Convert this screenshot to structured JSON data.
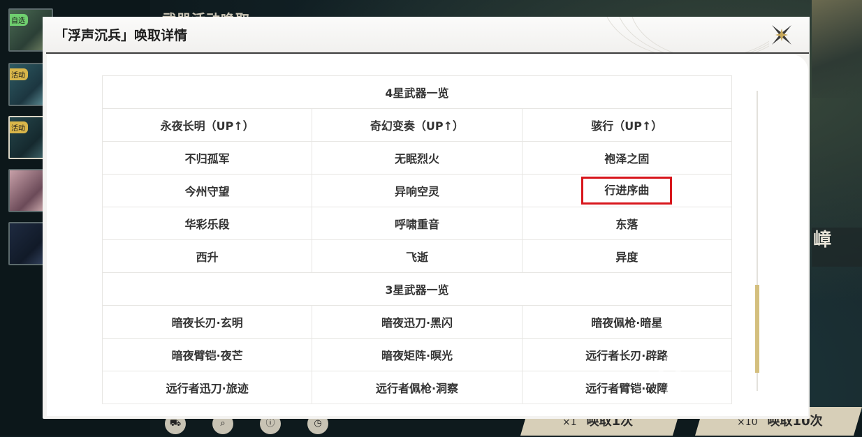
{
  "background": {
    "title": "武器活动唤取",
    "side_tags": [
      "自选",
      "活动",
      "活动"
    ],
    "right_name": "嶂",
    "summon_once": {
      "count": "×1",
      "label": "唤取1次"
    },
    "summon_ten": {
      "count": "×10",
      "label": "唤取10次"
    }
  },
  "dialog": {
    "title": "「浮声沉兵」唤取详情",
    "table": {
      "four_star_header": "4星武器一览",
      "four_star_rows": [
        [
          "永夜长明（UP↑）",
          "奇幻变奏（UP↑）",
          "骇行（UP↑）"
        ],
        [
          "不归孤军",
          "无眠烈火",
          "袍泽之固"
        ],
        [
          "今州守望",
          "异响空灵",
          "行进序曲"
        ],
        [
          "华彩乐段",
          "呼啸重音",
          "东落"
        ],
        [
          "西升",
          "飞逝",
          "异度"
        ]
      ],
      "three_star_header": "3星武器一览",
      "three_star_rows": [
        [
          "暗夜长刃·玄明",
          "暗夜迅刀·黑闪",
          "暗夜佩枪·暗星"
        ],
        [
          "暗夜臂铠·夜芒",
          "暗夜矩阵·暝光",
          "远行者长刃·辟路"
        ],
        [
          "远行者迅刀·旅迹",
          "远行者佩枪·洞察",
          "远行者臂铠·破障"
        ]
      ],
      "highlighted_item": "行进序曲"
    }
  },
  "colors": {
    "highlight": "#d8161c",
    "scroll_thumb": "#d4bf7e"
  }
}
